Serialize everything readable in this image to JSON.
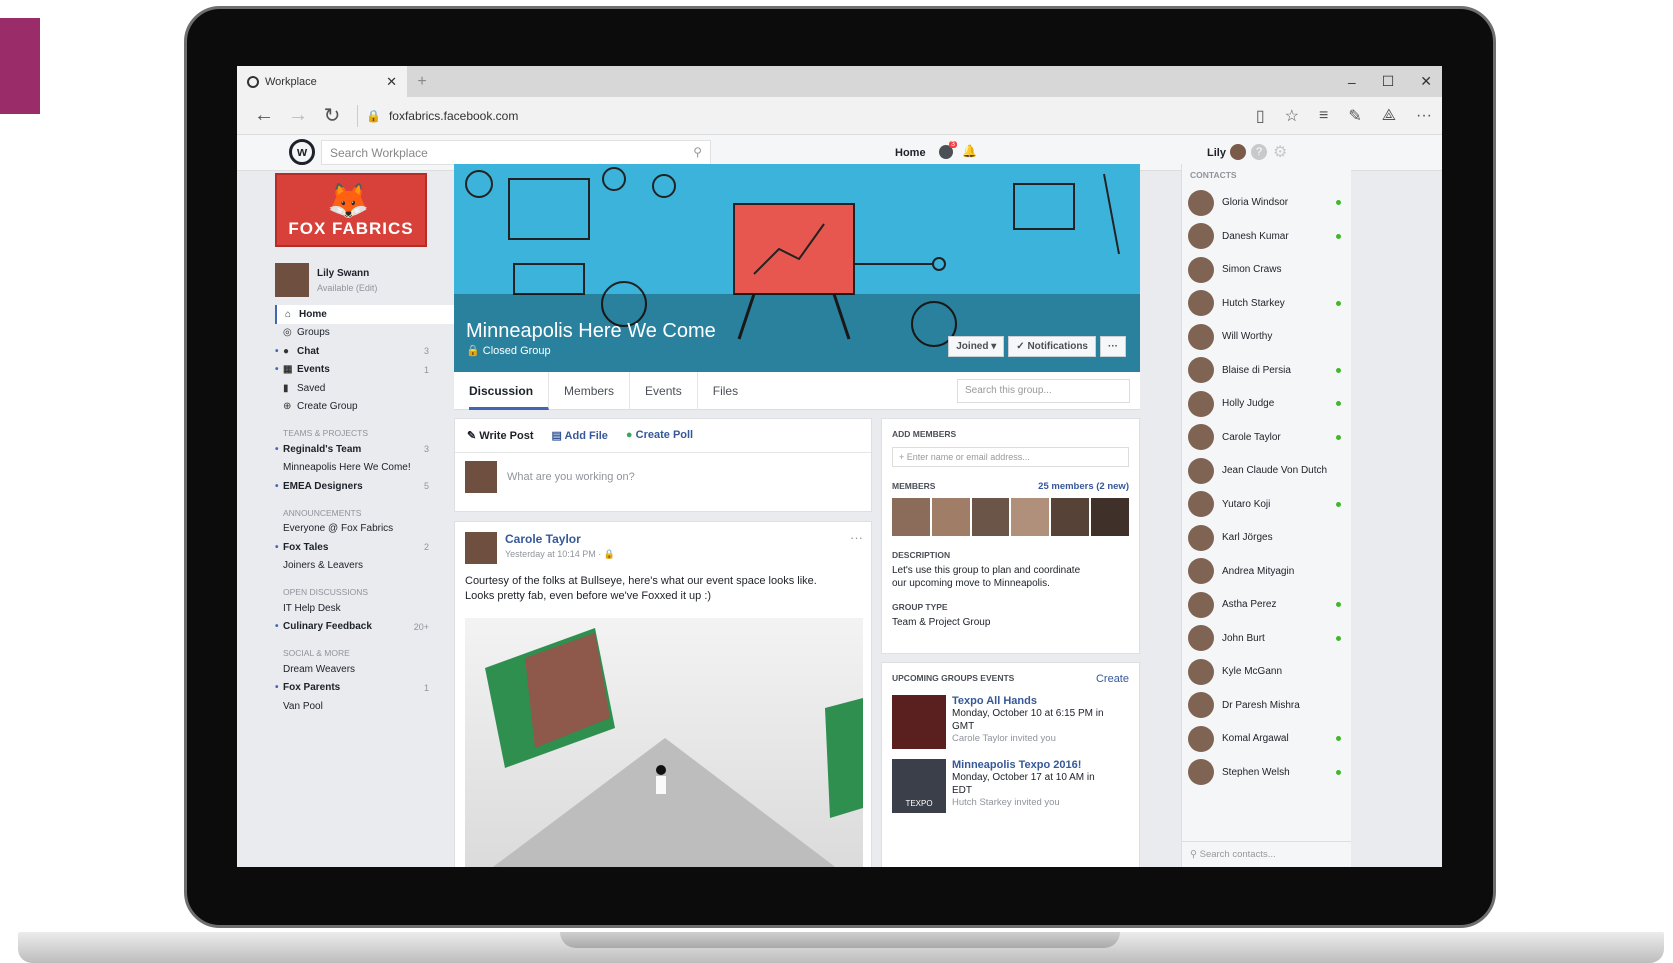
{
  "browser": {
    "tab_title": "Workplace",
    "tab_close": "✕",
    "new_tab": "+",
    "win_min": "–",
    "win_max": "☐",
    "win_close": "✕",
    "url": "foxfabrics.facebook.com"
  },
  "header": {
    "search_placeholder": "Search Workplace",
    "home": "Home",
    "notif_count": "3",
    "user": "Lily"
  },
  "sidebar": {
    "brand": "FOX FABRICS",
    "user_name": "Lily Swann",
    "user_status": "Available",
    "user_edit": "(Edit)",
    "nav": [
      {
        "label": "Home",
        "count": ""
      },
      {
        "label": "Groups",
        "count": ""
      },
      {
        "label": "Chat",
        "count": "3"
      },
      {
        "label": "Events",
        "count": "1"
      },
      {
        "label": "Saved",
        "count": ""
      },
      {
        "label": "Create Group",
        "count": ""
      }
    ],
    "sections": [
      {
        "title": "TEAMS & PROJECTS",
        "items": [
          {
            "label": "Reginald's Team",
            "count": "3"
          },
          {
            "label": "Minneapolis Here We Come!",
            "count": ""
          },
          {
            "label": "EMEA Designers",
            "count": "5"
          }
        ]
      },
      {
        "title": "ANNOUNCEMENTS",
        "items": [
          {
            "label": "Everyone @ Fox Fabrics",
            "count": ""
          },
          {
            "label": "Fox Tales",
            "count": "2"
          },
          {
            "label": "Joiners & Leavers",
            "count": ""
          }
        ]
      },
      {
        "title": "OPEN DISCUSSIONS",
        "items": [
          {
            "label": "IT Help Desk",
            "count": ""
          },
          {
            "label": "Culinary Feedback",
            "count": "20+"
          }
        ]
      },
      {
        "title": "SOCIAL & MORE",
        "items": [
          {
            "label": "Dream Weavers",
            "count": ""
          },
          {
            "label": "Fox Parents",
            "count": "1"
          },
          {
            "label": "Van Pool",
            "count": ""
          }
        ]
      }
    ]
  },
  "group": {
    "title": "Minneapolis Here We Come",
    "privacy": "Closed Group",
    "joined": "Joined ▾",
    "notifications": "✓ Notifications",
    "more": "···",
    "tabs": [
      "Discussion",
      "Members",
      "Events",
      "Files"
    ],
    "search_placeholder": "Search this group..."
  },
  "composer": {
    "write_post": "Write Post",
    "add_file": "Add File",
    "create_poll": "Create Poll",
    "placeholder": "What are you working on?"
  },
  "post": {
    "author": "Carole Taylor",
    "time": "Yesterday at 10:14 PM · 🔒",
    "more": "···",
    "text_line1": "Courtesy of the folks at Bullseye, here's what our event space looks like.",
    "text_line2": "Looks pretty fab, even before we've Foxxed it up :)"
  },
  "info": {
    "add_members": "ADD MEMBERS",
    "add_placeholder": "+ Enter name or email address...",
    "members_label": "MEMBERS",
    "members_count": "25 members (2 new)",
    "description_label": "DESCRIPTION",
    "description_line1": "Let's use this group to plan and coordinate",
    "description_line2": "our upcoming move to Minneapolis.",
    "group_type_label": "GROUP TYPE",
    "group_type": "Team & Project Group"
  },
  "events": {
    "heading": "UPCOMING GROUPS EVENTS",
    "create": "Create",
    "items": [
      {
        "title": "Texpo All Hands",
        "date_line1": "Monday, October 10 at 6:15 PM in",
        "date_line2": "GMT",
        "invited": "Carole Taylor invited you"
      },
      {
        "title": "Minneapolis Texpo 2016!",
        "date_line1": "Monday, October 17 at 10 AM in",
        "date_line2": "EDT",
        "invited": "Hutch Starkey invited you"
      }
    ],
    "thumb_label": "TEXPO"
  },
  "contacts": {
    "heading": "CONTACTS",
    "list": [
      {
        "name": "Gloria Windsor",
        "online": true
      },
      {
        "name": "Danesh Kumar",
        "online": true
      },
      {
        "name": "Simon Craws",
        "online": false
      },
      {
        "name": "Hutch Starkey",
        "online": true
      },
      {
        "name": "Will Worthy",
        "online": false
      },
      {
        "name": "Blaise di Persia",
        "online": true
      },
      {
        "name": "Holly Judge",
        "online": true
      },
      {
        "name": "Carole Taylor",
        "online": true
      },
      {
        "name": "Jean Claude Von Dutch",
        "online": false
      },
      {
        "name": "Yutaro Koji",
        "online": true
      },
      {
        "name": "Karl Jörges",
        "online": false
      },
      {
        "name": "Andrea Mityagin",
        "online": false
      },
      {
        "name": "Astha Perez",
        "online": true
      },
      {
        "name": "John Burt",
        "online": true
      },
      {
        "name": "Kyle McGann",
        "online": false
      },
      {
        "name": "Dr Paresh Mishra",
        "online": false
      },
      {
        "name": "Komal Argawal",
        "online": true
      },
      {
        "name": "Stephen Welsh",
        "online": true
      }
    ],
    "search_placeholder": "Search contacts..."
  },
  "colors": {
    "cover": "#3bb3db",
    "accent": "#4267b2",
    "link": "#365899",
    "brand_red": "#d8413a",
    "online": "#42b72a"
  }
}
